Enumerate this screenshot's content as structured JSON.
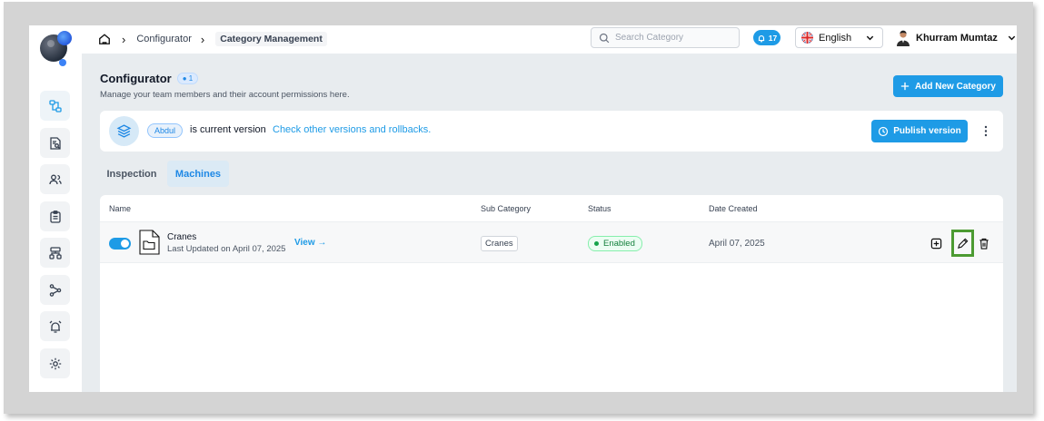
{
  "breadcrumb": {
    "items": [
      "Configurator",
      "Category Management"
    ]
  },
  "search": {
    "placeholder": "Search Category",
    "value": ""
  },
  "notifications": {
    "count": "17"
  },
  "language": {
    "selected": "English"
  },
  "user": {
    "name": "Khurram Mumtaz"
  },
  "header": {
    "title": "Configurator",
    "count": "1",
    "subtitle": "Manage your team members and their account permissions here.",
    "add_button": "Add New Category"
  },
  "version": {
    "owner": "Abdul",
    "text": "is current version",
    "link": "Check other versions and rollbacks.",
    "publish_button": "Publish version"
  },
  "tabs": [
    {
      "label": "Inspection",
      "active": false
    },
    {
      "label": "Machines",
      "active": true
    }
  ],
  "table": {
    "columns": [
      "Name",
      "Sub Category",
      "Status",
      "Date Created"
    ],
    "rows": [
      {
        "enabled": true,
        "name": "Cranes",
        "last_updated": "Last Updated on April 07, 2025",
        "view_label": "View",
        "sub_category": "Cranes",
        "status": "Enabled",
        "date_created": "April 07, 2025"
      }
    ]
  },
  "colors": {
    "primary": "#1e9be6",
    "success": "#16a34a",
    "highlight": "#4c9b32"
  },
  "icons": {
    "sidebar": [
      "flow-icon",
      "document-search-icon",
      "users-icon",
      "clipboard-icon",
      "hierarchy-icon",
      "branch-icon",
      "alarm-icon",
      "settings-icon"
    ]
  }
}
